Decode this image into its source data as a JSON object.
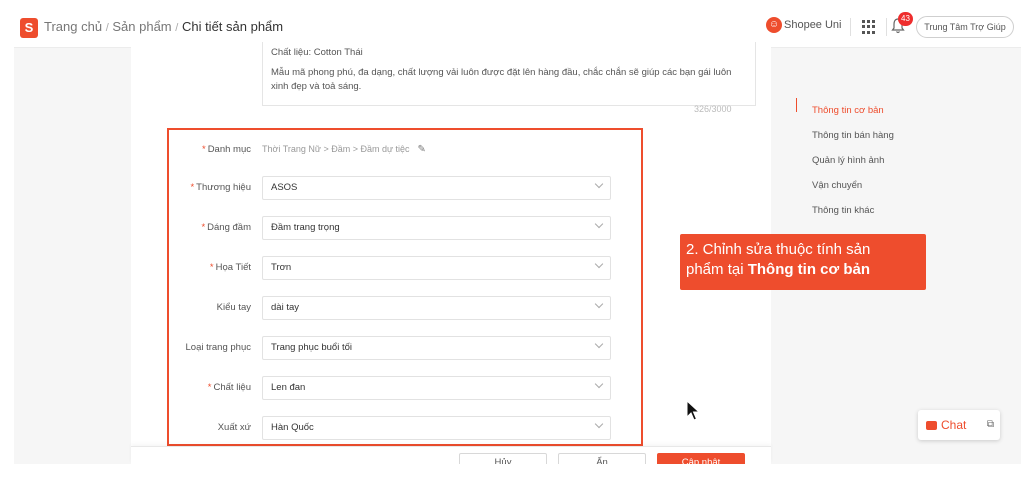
{
  "header": {
    "logo_letter": "S",
    "breadcrumb": [
      "Trang chủ",
      "Sản phẩm",
      "Chi tiết sản phẩm"
    ],
    "breadcrumb_sep": "/",
    "shopee_uni": "Shopee Uni",
    "notification_count": "43",
    "help_center": "Trung Tâm Trợ Giúp"
  },
  "description": {
    "material_line": "Chất liệu: Cotton Thái",
    "body": "Mẫu mã phong phú, đa dạng, chất lượng vải luôn được đặt lên hàng đầu, chắc chắn sẽ giúp các bạn gái luôn xinh đẹp và toả sáng.",
    "counter": "326/3000"
  },
  "form": {
    "category": {
      "label": "Danh mục",
      "value": "Thời Trang Nữ > Đầm > Đầm dự tiệc",
      "required": true
    },
    "fields": [
      {
        "label": "Thương hiệu",
        "value": "ASOS",
        "required": true
      },
      {
        "label": "Dáng đầm",
        "value": "Đầm trang trọng",
        "required": true
      },
      {
        "label": "Họa Tiết",
        "value": "Trơn",
        "required": true
      },
      {
        "label": "Kiểu tay",
        "value": "dài tay",
        "required": false
      },
      {
        "label": "Loại trang phục",
        "value": "Trang phục buổi tối",
        "required": false
      },
      {
        "label": "Chất liệu",
        "value": "Len đan",
        "required": true
      },
      {
        "label": "Xuất xứ",
        "value": "Hàn Quốc",
        "required": false
      }
    ]
  },
  "callout": {
    "line1": "2. Chỉnh sửa thuộc tính sản",
    "line2_prefix": "phẩm tại ",
    "line2_bold": "Thông tin cơ bản"
  },
  "sidebar": {
    "items": [
      {
        "label": "Thông tin cơ bản",
        "active": true
      },
      {
        "label": "Thông tin bán hàng",
        "active": false
      },
      {
        "label": "Quản lý hình ảnh",
        "active": false
      },
      {
        "label": "Vận chuyển",
        "active": false
      },
      {
        "label": "Thông tin khác",
        "active": false
      }
    ]
  },
  "chat": {
    "label": "Chat"
  },
  "actions": {
    "cancel": "Hủy",
    "hide": "Ẩn",
    "update": "Cập nhật"
  },
  "colors": {
    "brand": "#ee4d2d"
  },
  "icons": [
    "shopee-logo-icon",
    "shopee-uni-icon",
    "apps-grid-icon",
    "bell-icon",
    "pencil-icon",
    "chevron-down-icon",
    "chat-icon",
    "external-window-icon",
    "mouse-cursor-icon"
  ]
}
